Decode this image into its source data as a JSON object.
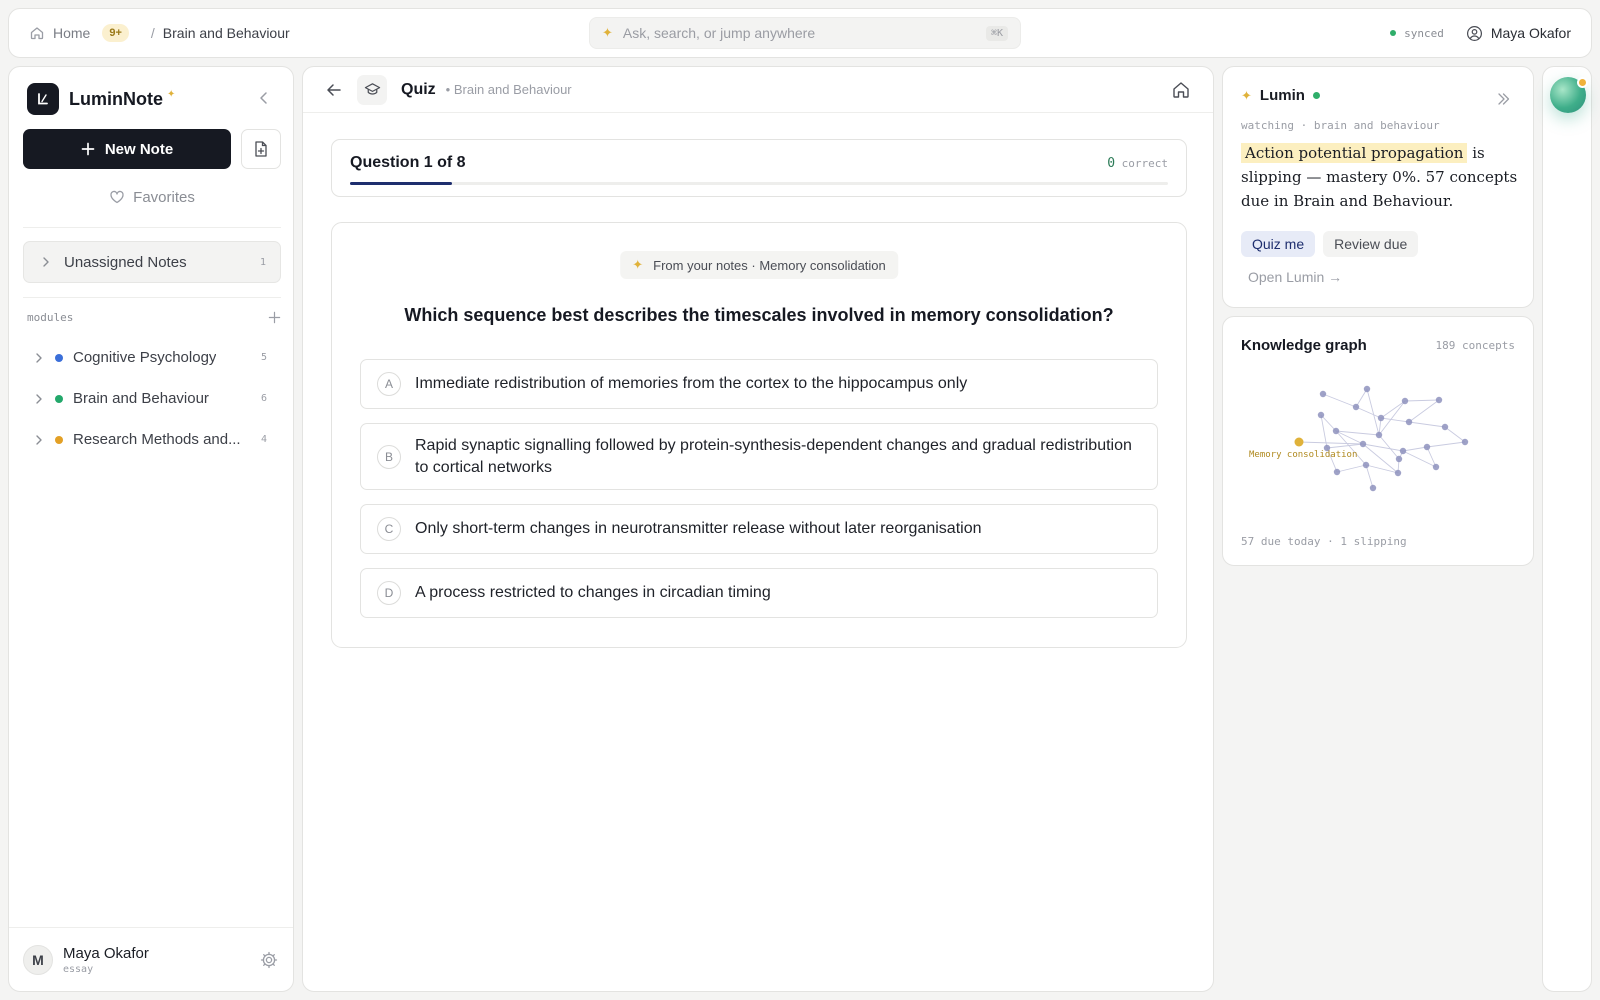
{
  "topbar": {
    "home_label": "Home",
    "notif_badge": "9+",
    "breadcrumb_sep": "/",
    "breadcrumb_current": "Brain and Behaviour",
    "search_placeholder": "Ask, search, or jump anywhere",
    "search_shortcut": "⌘K",
    "sync_status": "synced",
    "user_name": "Maya Okafor"
  },
  "sidebar": {
    "brand_name": "LuminNote",
    "brand_star": "✦",
    "new_note_label": "New Note",
    "favorites_label": "Favorites",
    "unassigned": {
      "label": "Unassigned Notes",
      "count": "1"
    },
    "modules_heading": "modules",
    "modules": [
      {
        "label": "Cognitive Psychology",
        "count": "5",
        "color": "#3b6fd9"
      },
      {
        "label": "Brain and Behaviour",
        "count": "6",
        "color": "#23a86b"
      },
      {
        "label": "Research Methods and...",
        "count": "4",
        "color": "#e3a025"
      }
    ],
    "user": {
      "initial": "M",
      "name": "Maya Okafor",
      "subtitle": "essay"
    }
  },
  "main": {
    "title": "Quiz",
    "subtitle": "• Brain and Behaviour",
    "progress": {
      "label": "Question 1 of 8",
      "correct_count": "0",
      "correct_label": "correct",
      "fraction": 0.125
    },
    "source_chip": "From your notes · Memory consolidation",
    "question": "Which sequence best describes the timescales involved in memory consolidation?",
    "options": [
      {
        "letter": "A",
        "text": "Immediate redistribution of memories from the cortex to the hippocampus only"
      },
      {
        "letter": "B",
        "text": "Rapid synaptic signalling followed by protein-synthesis-dependent changes and gradual redistribution to cortical networks"
      },
      {
        "letter": "C",
        "text": "Only short-term changes in neurotransmitter release without later reorganisation"
      },
      {
        "letter": "D",
        "text": "A process restricted to changes in circadian timing"
      }
    ]
  },
  "lumin": {
    "title": "Lumin",
    "watching": "watching · brain and behaviour",
    "insight_highlight": "Action potential propagation",
    "insight_rest": " is slipping — mastery 0%. 57 concepts due in Brain and Behaviour.",
    "quiz_me": "Quiz me",
    "review_due": "Review due",
    "open_lumin": "Open Lumin →"
  },
  "knowledge_graph": {
    "title": "Knowledge graph",
    "count_label": "189 concepts",
    "focus_label": "Memory consolidation",
    "footer": "57 due today · 1 slipping"
  }
}
